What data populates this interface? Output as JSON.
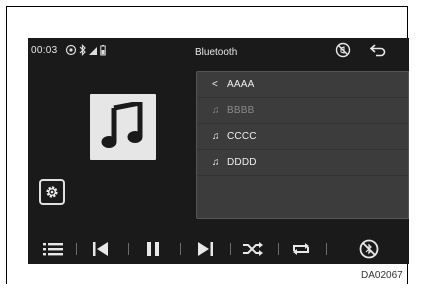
{
  "status_bar": {
    "time": "00:03",
    "title": "Bluetooth"
  },
  "list": {
    "items": [
      {
        "icon": "back-arrow",
        "label": "AAAA",
        "glyph": "<"
      },
      {
        "icon": "music-note-icon",
        "label": "BBBB",
        "glyph": "♫",
        "dimmed": true
      },
      {
        "icon": "music-note-icon",
        "label": "CCCC",
        "glyph": "♫"
      },
      {
        "icon": "music-note-icon",
        "label": "DDDD",
        "glyph": "♫"
      }
    ]
  },
  "controls": [
    "list-menu",
    "previous-track",
    "pause",
    "next-track",
    "shuffle",
    "repeat",
    "disconnect"
  ],
  "figure_code": "DA02067",
  "colors": {
    "screen": "#1a1a1a",
    "list_bg": "#3c3c3c",
    "text": "#e8e8e8"
  }
}
